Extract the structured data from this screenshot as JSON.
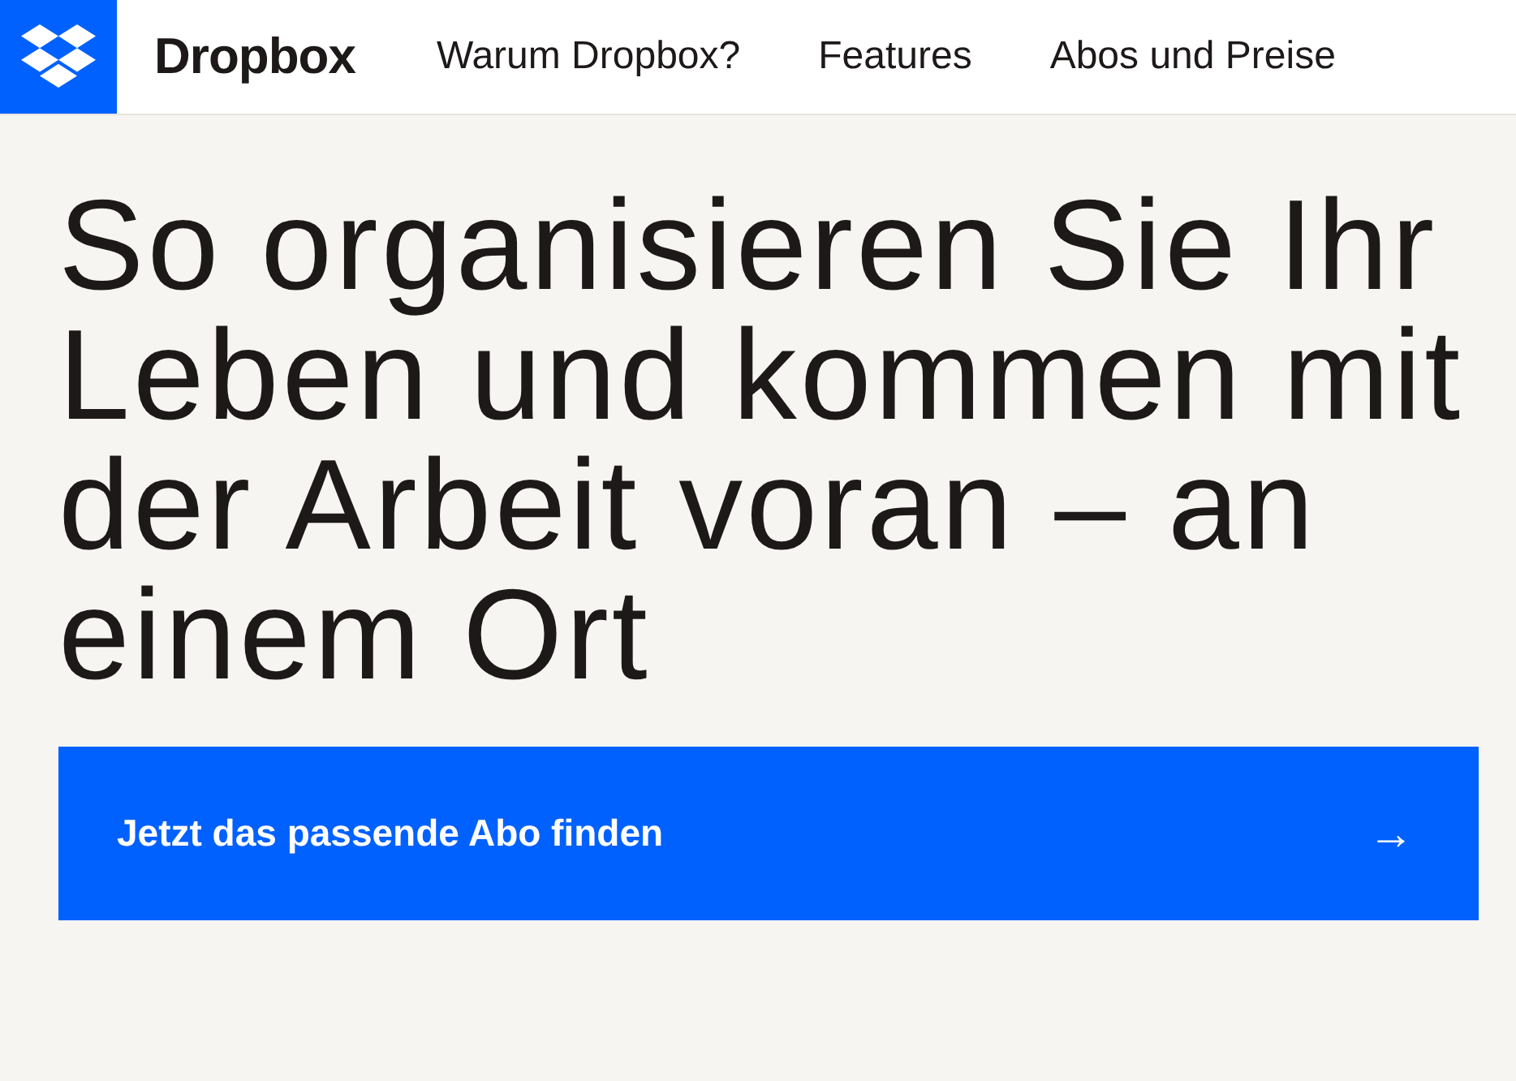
{
  "header": {
    "brand": "Dropbox",
    "nav": [
      {
        "label": "Warum Dropbox?"
      },
      {
        "label": "Features"
      },
      {
        "label": "Abos und Preise"
      }
    ]
  },
  "hero": {
    "heading": "So organisieren Sie Ihr Leben und kommen mit der Arbeit voran – an einem Ort",
    "cta": {
      "label": "Jetzt das passende Abo finden",
      "icon": "→"
    }
  }
}
